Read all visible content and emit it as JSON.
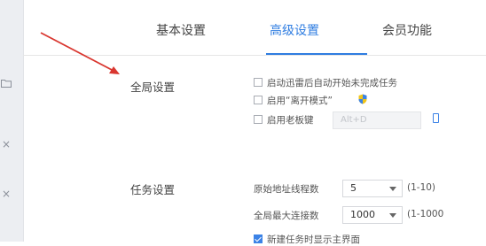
{
  "tabs": [
    {
      "label": "基本设置",
      "active": false
    },
    {
      "label": "高级设置",
      "active": true
    },
    {
      "label": "会员功能",
      "active": false
    }
  ],
  "global": {
    "label": "全局设置",
    "options": [
      {
        "label": "启动迅雷后自动开始未完成任务",
        "checked": false
      },
      {
        "label": "启用“离开模式”",
        "checked": false
      },
      {
        "label": "启用老板键",
        "checked": false
      }
    ],
    "hotkey_value": "Alt+D"
  },
  "task": {
    "label": "任务设置",
    "rows": [
      {
        "label": "原始地址线程数",
        "value": "5",
        "range": "(1-10)"
      },
      {
        "label": "全局最大连接数",
        "value": "1000",
        "range": "(1-1000"
      }
    ],
    "last_option": {
      "label": "新建任务时显示主界面",
      "checked": true
    }
  },
  "colors": {
    "accent": "#2f7de1",
    "annotation": "#d9362f"
  },
  "icons": {
    "shield": "uac-shield-icon",
    "folder": "folder-icon",
    "close": "close-icon"
  }
}
